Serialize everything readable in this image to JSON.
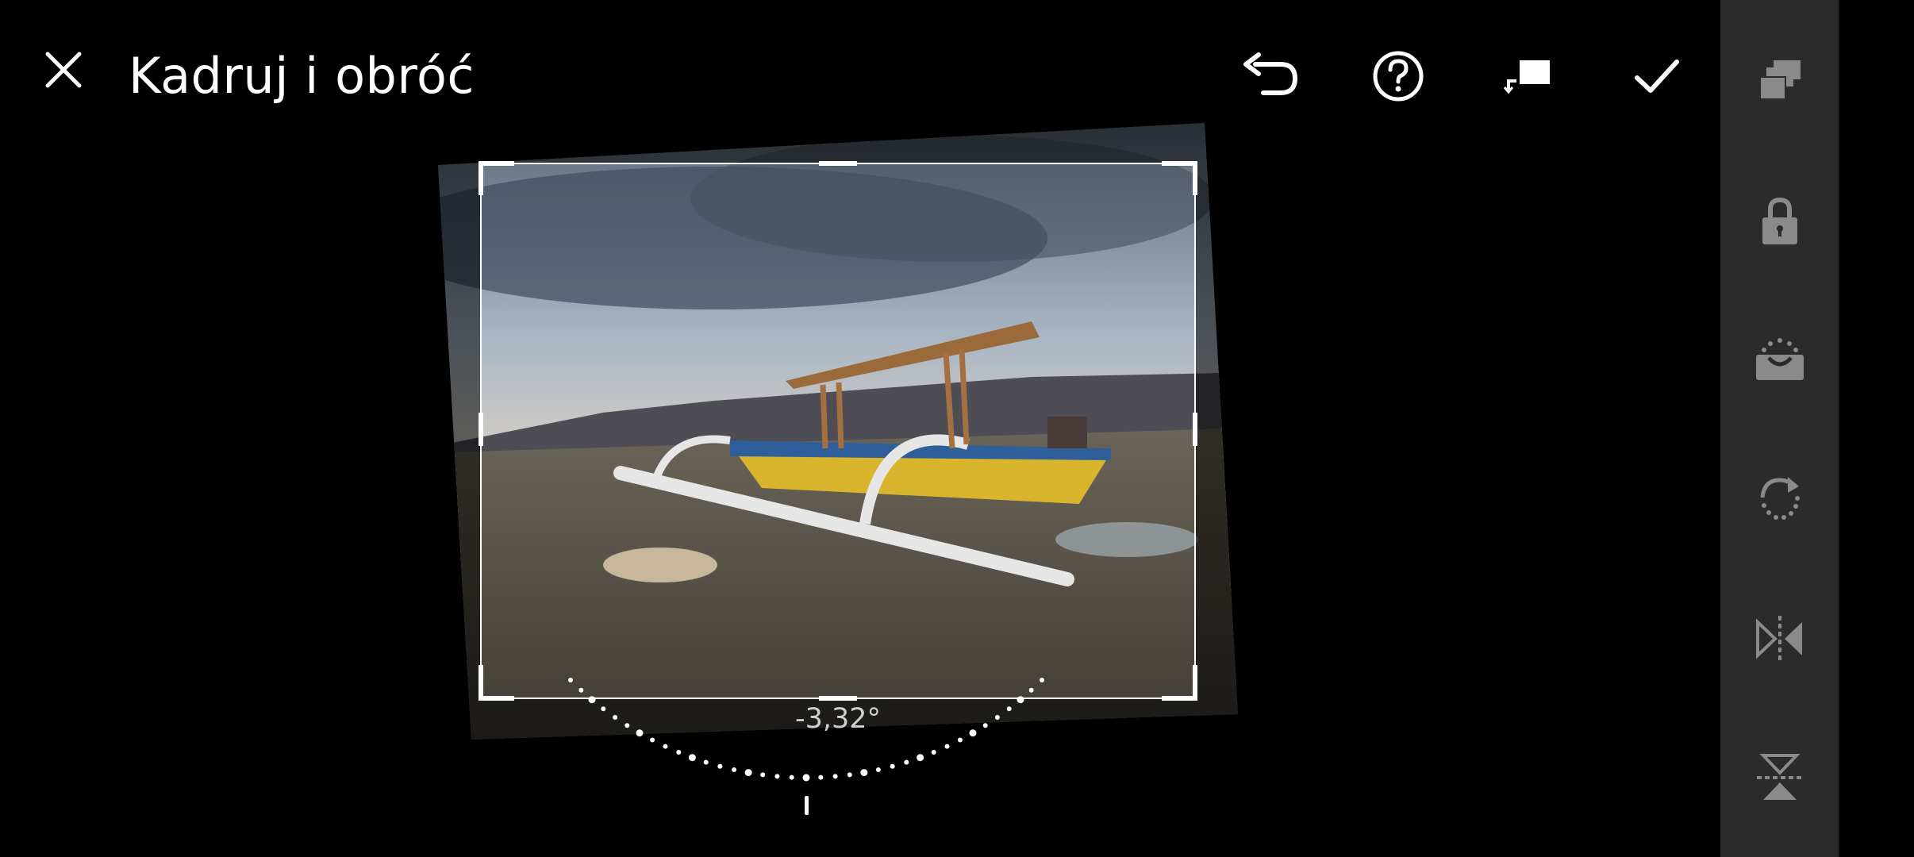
{
  "header": {
    "title": "Kadruj i obróć",
    "close_icon": "close-icon",
    "undo_icon": "undo-icon",
    "help_icon": "help-icon",
    "rotate_crop_icon": "rotate-crop-icon",
    "confirm_icon": "checkmark-icon"
  },
  "editor": {
    "straighten_angle": "-3,32°",
    "angle_value_degrees": -3.32
  },
  "sidebar": {
    "items": [
      {
        "name": "aspect-ratio-icon"
      },
      {
        "name": "lock-icon"
      },
      {
        "name": "auto-straighten-icon"
      },
      {
        "name": "rotate-icon"
      },
      {
        "name": "flip-horizontal-icon"
      },
      {
        "name": "flip-vertical-icon"
      }
    ]
  },
  "colors": {
    "background": "#000000",
    "rail": "#2b2b2b",
    "icon_rail": "#8a8a8a",
    "foreground": "#ffffff"
  }
}
